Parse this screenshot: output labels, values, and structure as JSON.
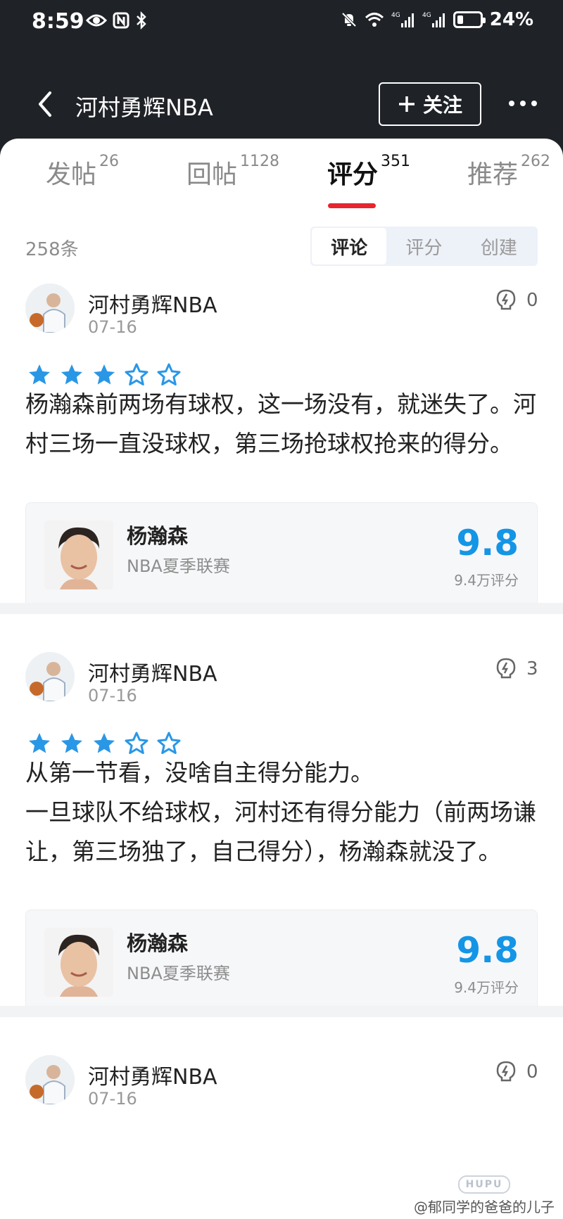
{
  "status_bar": {
    "time": "8:59",
    "network_1": "4G",
    "network_2": "4G",
    "battery_percent": 24,
    "battery_text": "24%",
    "left_icons": [
      "eye-icon",
      "nfc-icon",
      "bluetooth-icon"
    ],
    "right_icons": [
      "mute-icon",
      "wifi-icon",
      "signal-icon",
      "signal-icon",
      "battery-icon"
    ]
  },
  "nav": {
    "title": "河村勇辉NBA",
    "follow_label": "关注",
    "back_icon": "chevron-left-icon",
    "more_icon": "more-dots-icon"
  },
  "tabs": [
    {
      "label": "发帖",
      "count": "26"
    },
    {
      "label": "回帖",
      "count": "1128"
    },
    {
      "label": "评分",
      "count": "351",
      "active": true
    },
    {
      "label": "推荐",
      "count": "262"
    }
  ],
  "filter": {
    "count_text": "258条",
    "options": [
      "评论",
      "评分",
      "创建"
    ],
    "active": "评论"
  },
  "posts": [
    {
      "author": "河村勇辉NBA",
      "date": "07-16",
      "likes": "0",
      "rating": 3,
      "text": "杨瀚森前两场有球权，这一场没有，就迷失了。河村三场一直没球权，第三场抢球权抢来的得分。",
      "card": {
        "name": "杨瀚森",
        "league": "NBA夏季联赛",
        "score": "9.8",
        "votes": "9.4万评分"
      }
    },
    {
      "author": "河村勇辉NBA",
      "date": "07-16",
      "likes": "3",
      "rating": 3,
      "text_line_1": "从第一节看，没啥自主得分能力。",
      "text_line_2": "一旦球队不给球权，河村还有得分能力（前两场谦让，第三场独了，自己得分），杨瀚森就没了。",
      "card": {
        "name": "杨瀚森",
        "league": "NBA夏季联赛",
        "score": "9.8",
        "votes": "9.4万评分"
      }
    },
    {
      "author": "河村勇辉NBA",
      "date": "07-16",
      "likes": "0"
    }
  ],
  "colors": {
    "header_bg": "#1f2227",
    "accent_red": "#e8242f",
    "star_blue": "#2a97e6",
    "score_blue": "#1495e6"
  },
  "watermark": "@郁同学的爸爸的儿子",
  "logo_text": "HUPU"
}
